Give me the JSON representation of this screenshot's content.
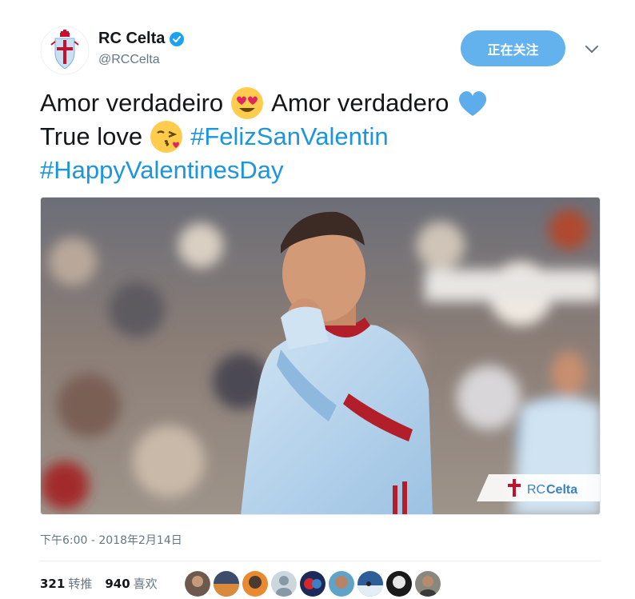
{
  "account": {
    "name": "RC Celta",
    "handle": "@RCCelta",
    "verified_icon": "verified-badge-icon"
  },
  "follow_button": {
    "label": "正在关注"
  },
  "tweet": {
    "line1_text_a": "Amor verdadeiro",
    "line1_emoji": "heart-eyes-emoji",
    "line1_text_b": "Amor verdadero",
    "line1_emoji_2": "blue-heart-emoji",
    "line2_text": "True love",
    "line2_emoji": "kissing-face-emoji",
    "hashtag_1": "#FelizSanValentin",
    "hashtag_2": "#HappyValentinesDay"
  },
  "media": {
    "watermark": "RCCelta",
    "watermark_rc": "RC",
    "watermark_celta": "Celta"
  },
  "timestamp": "下午6:00 - 2018年2月14日",
  "stats": {
    "retweets_count": "321",
    "retweets_label": "转推",
    "likes_count": "940",
    "likes_label": "喜欢"
  },
  "likers": [
    "avatar-1",
    "avatar-2",
    "avatar-3",
    "avatar-4",
    "avatar-5",
    "avatar-6",
    "avatar-7",
    "avatar-8",
    "avatar-9"
  ],
  "colors": {
    "accent": "#1da1f2",
    "hashtag": "#1b95e0",
    "follow_button": "#63b2ee",
    "secondary_text": "#657786"
  }
}
